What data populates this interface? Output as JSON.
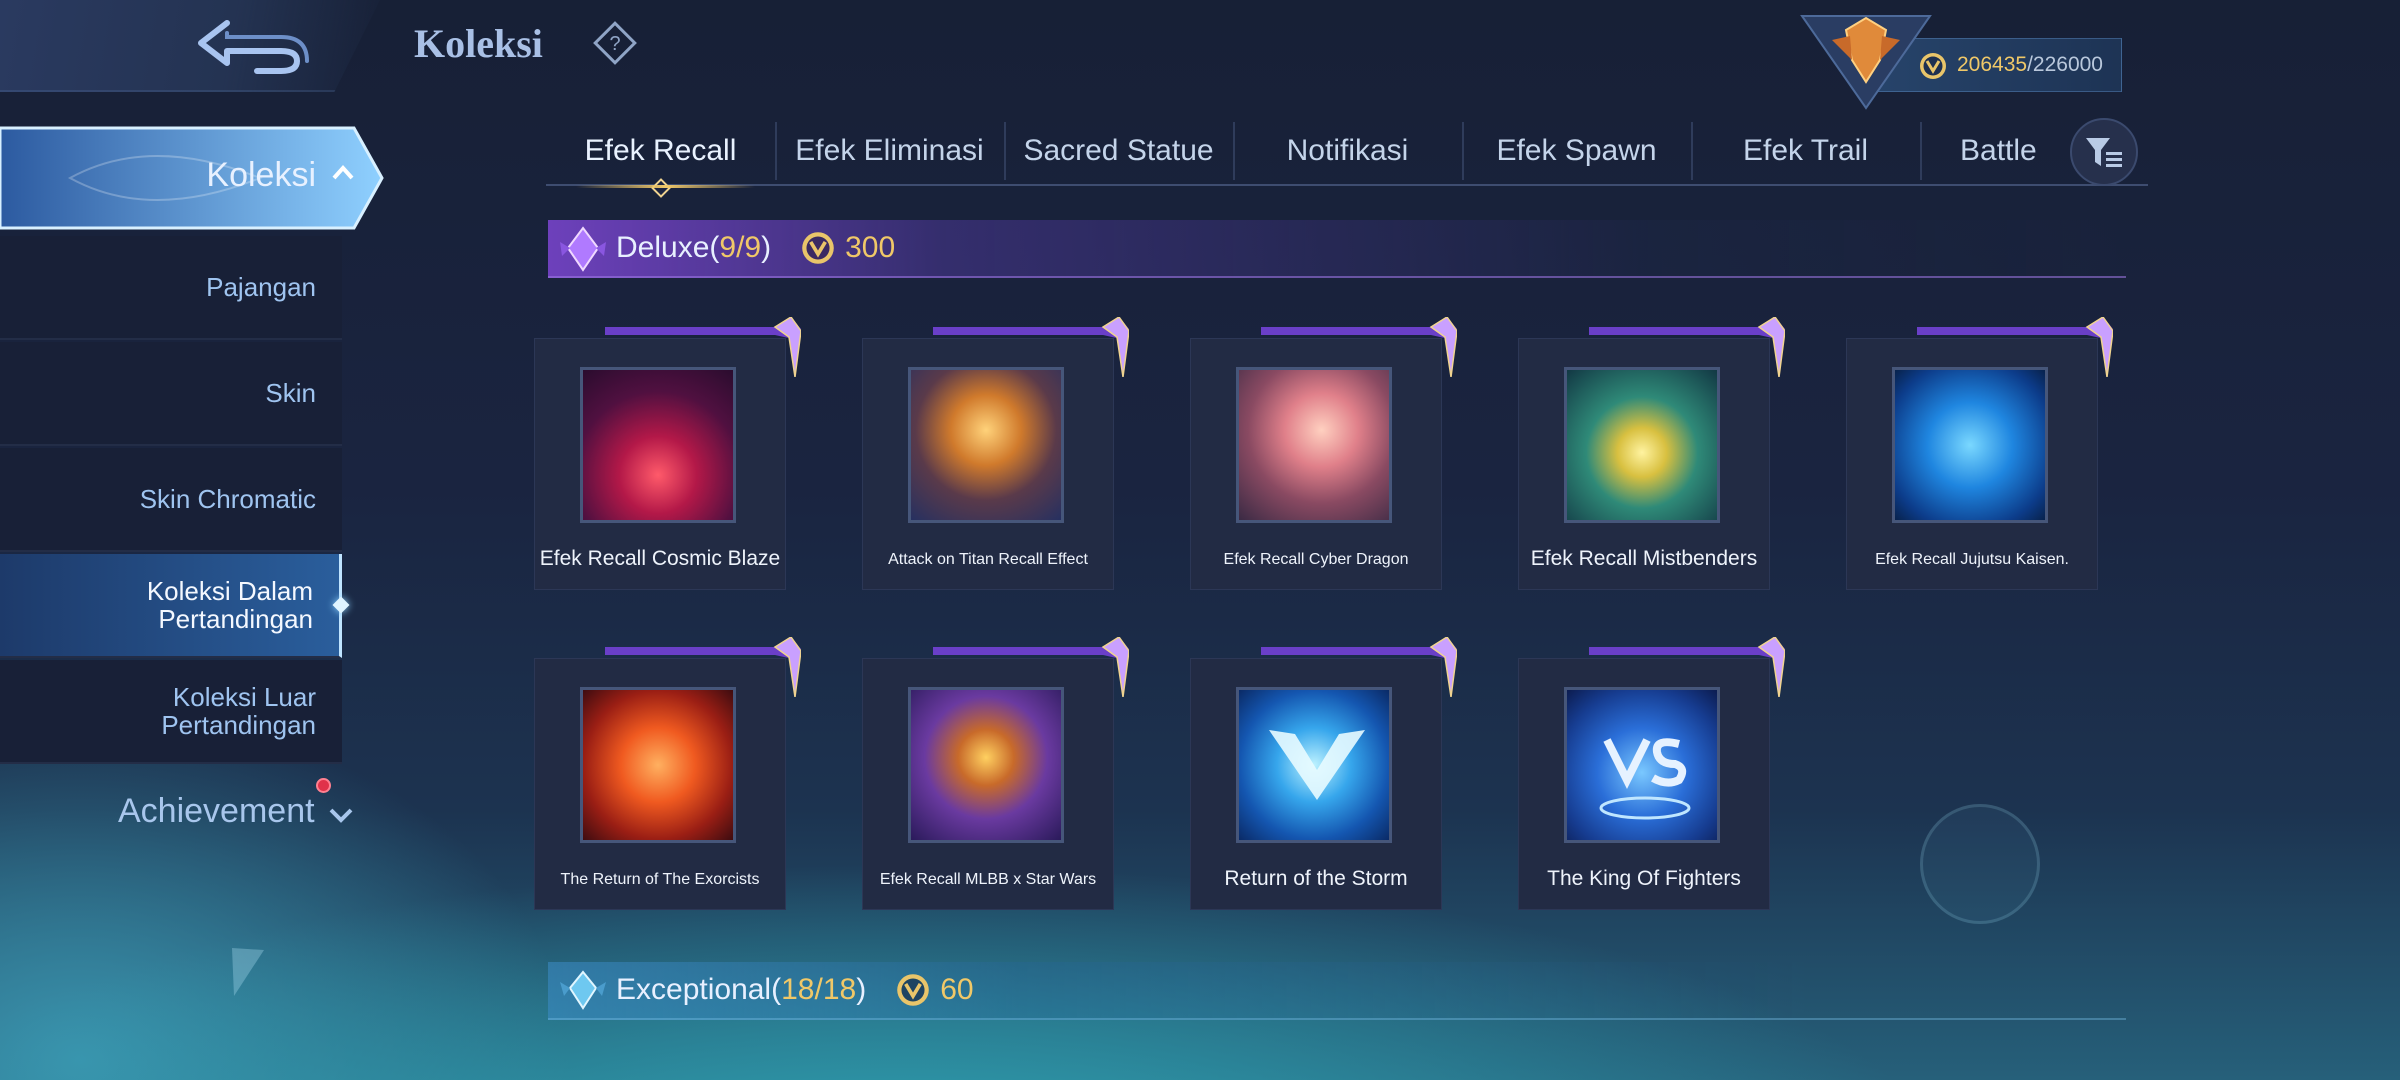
{
  "header": {
    "title": "Koleksi",
    "points_value": "206435",
    "points_max": "/226000"
  },
  "sidebar": {
    "top_label": "Koleksi",
    "items": [
      {
        "label": "Pajangan"
      },
      {
        "label": "Skin"
      },
      {
        "label": "Skin Chromatic"
      },
      {
        "label": "Koleksi Dalam Pertandingan"
      },
      {
        "label": "Koleksi Luar Pertandingan"
      }
    ],
    "achievement_label": "Achievement"
  },
  "tabs": [
    "Efek Recall",
    "Efek Eliminasi",
    "Sacred Statue",
    "Notifikasi",
    "Efek Spawn",
    "Efek Trail",
    "Battle"
  ],
  "sections": {
    "deluxe": {
      "name": "Deluxe",
      "count_open": "(",
      "count": "9/9",
      "count_close": ")",
      "price": "300"
    },
    "exceptional": {
      "name": "Exceptional",
      "count_open": "(",
      "count": "18/18",
      "count_close": ")",
      "price": "60"
    }
  },
  "items": [
    {
      "name": "Efek Recall Cosmic Blaze"
    },
    {
      "name": "Attack on Titan Recall Effect"
    },
    {
      "name": "Efek Recall Cyber Dragon"
    },
    {
      "name": "Efek Recall Mistbenders"
    },
    {
      "name": "Efek Recall Jujutsu Kaisen."
    },
    {
      "name": "The Return of The Exorcists"
    },
    {
      "name": "Efek Recall MLBB x Star Wars"
    },
    {
      "name": "Return of the Storm"
    },
    {
      "name": "The King Of Fighters"
    }
  ],
  "colors": {
    "accent_gold": "#f0c868",
    "deluxe_purple": "#7c46d2",
    "sidebar_active": "#2a5e9c"
  },
  "icons": {
    "back": "back-arrow-icon",
    "help": "question-diamond-icon",
    "coin": "coin-icon",
    "rank": "rank-emblem-icon",
    "filter": "filter-icon"
  }
}
